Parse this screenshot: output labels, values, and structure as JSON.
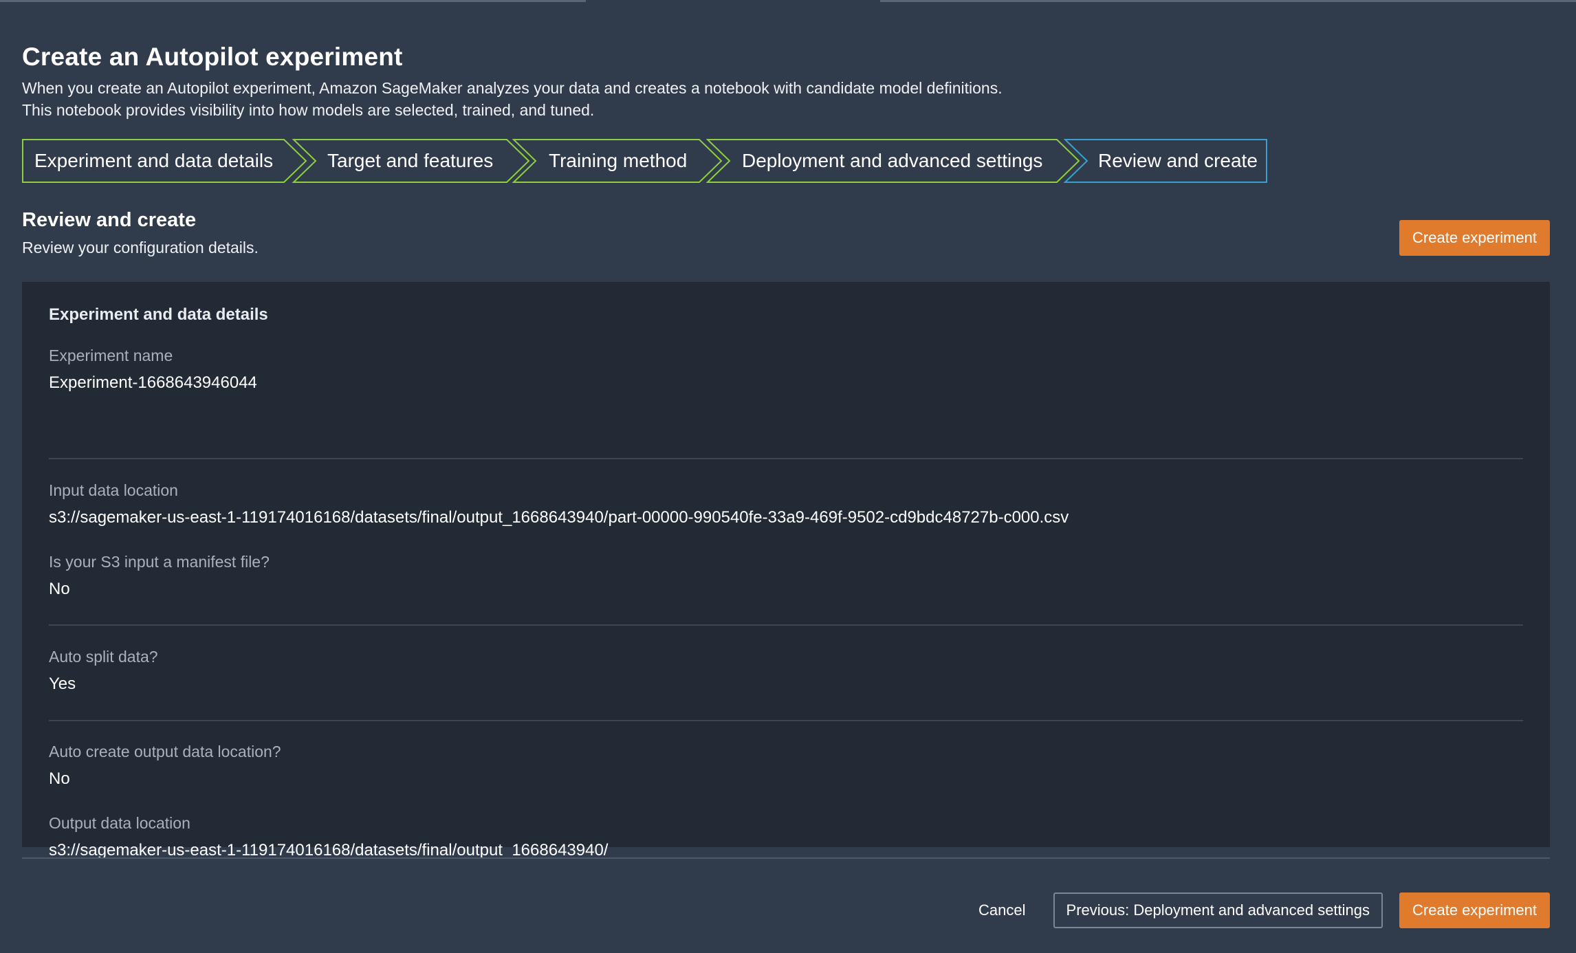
{
  "page": {
    "title": "Create an Autopilot experiment",
    "description_line1": "When you create an Autopilot experiment, Amazon SageMaker analyzes your data and creates a notebook with candidate model definitions.",
    "description_line2": "This notebook provides visibility into how models are selected, trained, and tuned."
  },
  "steps": [
    {
      "label": "Experiment and data details",
      "status": "completed"
    },
    {
      "label": "Target and features",
      "status": "completed"
    },
    {
      "label": "Training method",
      "status": "completed"
    },
    {
      "label": "Deployment and advanced settings",
      "status": "completed"
    },
    {
      "label": "Review and create",
      "status": "current"
    }
  ],
  "colors": {
    "completed_step_border": "#8fcf3f",
    "current_step_border": "#39a2cc",
    "primary_button": "#e07b2e",
    "background": "#303b4b",
    "panel": "#222a35"
  },
  "section": {
    "title": "Review and create",
    "description": "Review your configuration details."
  },
  "buttons": {
    "create_experiment": "Create experiment",
    "cancel": "Cancel",
    "previous": "Previous: Deployment and advanced settings"
  },
  "panel": {
    "heading": "Experiment and data details",
    "fields": [
      {
        "label": "Experiment name",
        "value": "Experiment-1668643946044"
      },
      {
        "label": "Input data location",
        "value": "s3://sagemaker-us-east-1-119174016168/datasets/final/output_1668643940/part-00000-990540fe-33a9-469f-9502-cd9bdc48727b-c000.csv"
      },
      {
        "label": "Is your S3 input a manifest file?",
        "value": "No"
      },
      {
        "label": "Auto split data?",
        "value": "Yes"
      },
      {
        "label": "Auto create output data location?",
        "value": "No"
      },
      {
        "label": "Output data location",
        "value": "s3://sagemaker-us-east-1-119174016168/datasets/final/output_1668643940/"
      }
    ]
  }
}
